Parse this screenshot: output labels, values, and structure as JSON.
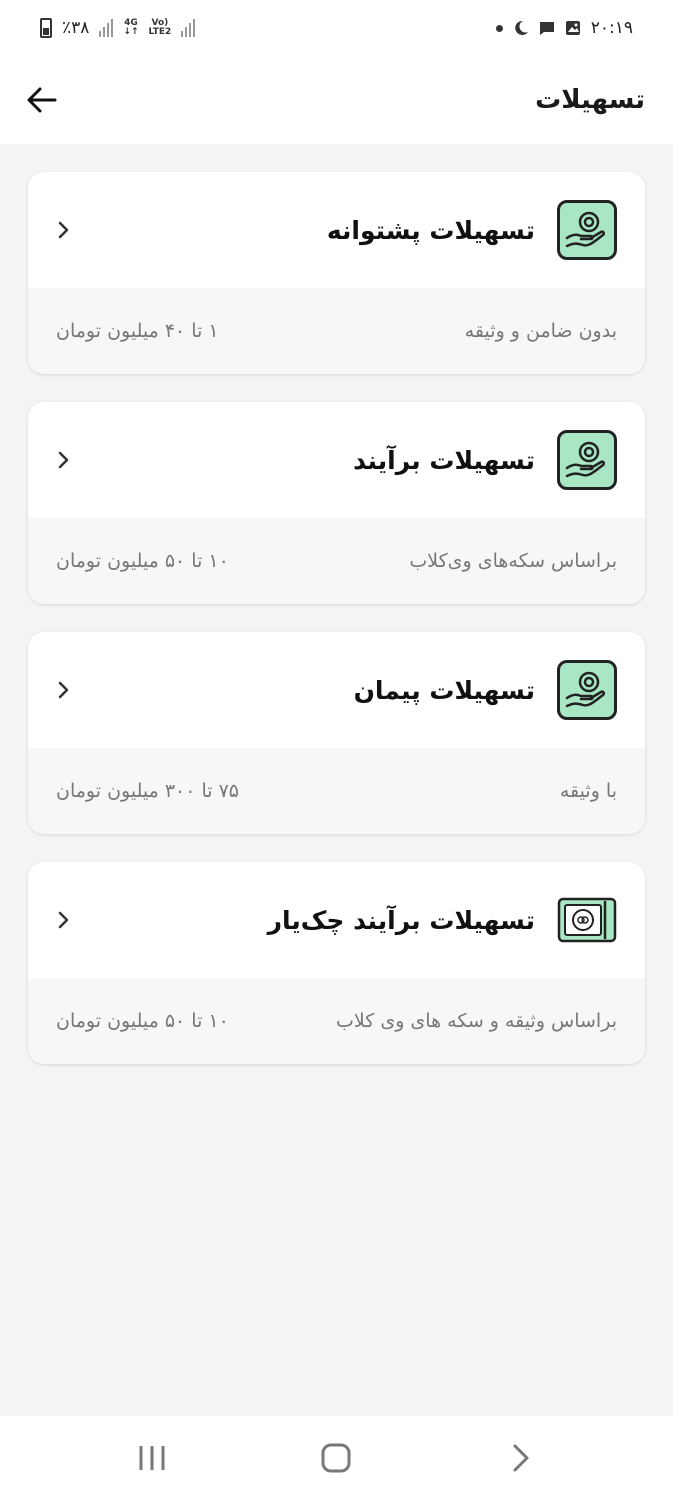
{
  "status_bar": {
    "time": "۲۰:۱۹",
    "battery": "٪۳۸",
    "network_top": "4G",
    "network_lte_top": "Vo)",
    "network_lte_bottom": "LTE2"
  },
  "header": {
    "title": "تسهیلات"
  },
  "cards": [
    {
      "title": "تسهیلات پشتوانه",
      "subtitle": "بدون ضامن و وثیقه",
      "range": "۱ تا ۴۰ میلیون تومان",
      "icon": "hand-coin-icon"
    },
    {
      "title": "تسهیلات برآیند",
      "subtitle": "براساس سکه‌های وی‌کلاب",
      "range": "۱۰ تا ۵۰ میلیون تومان",
      "icon": "hand-coin-icon"
    },
    {
      "title": "تسهیلات پیمان",
      "subtitle": "با وثیقه",
      "range": "۷۵ تا ۳۰۰ میلیون تومان",
      "icon": "hand-coin-icon"
    },
    {
      "title": "تسهیلات برآیند چک‌یار",
      "subtitle": "براساس وثیقه و سکه های وی کلاب",
      "range": "۱۰ تا ۵۰ میلیون تومان",
      "icon": "cheque-icon"
    }
  ],
  "colors": {
    "icon_bg": "#a8e6c4",
    "icon_stroke": "#222222",
    "page_bg": "#f4f4f4"
  }
}
